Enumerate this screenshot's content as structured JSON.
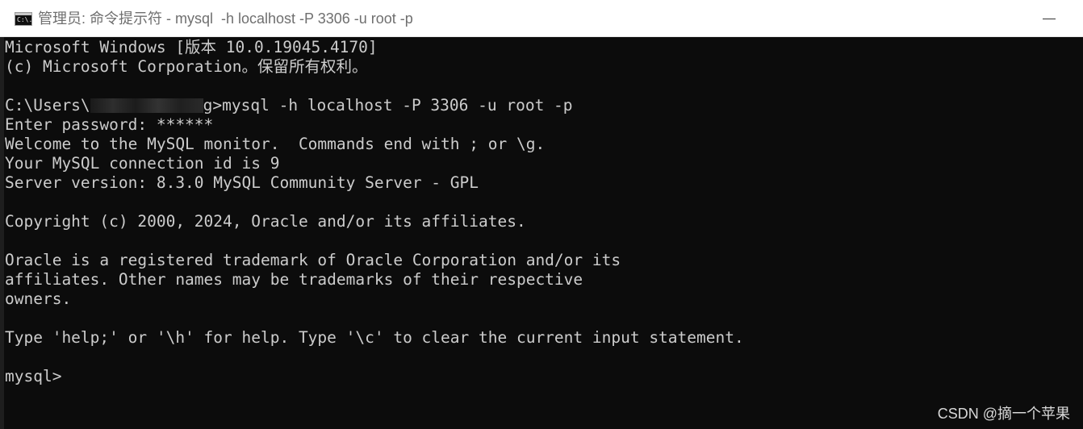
{
  "window": {
    "title": "管理员: 命令提示符 - mysql  -h localhost -P 3306 -u root -p",
    "icon": "cmd-icon",
    "icon_prompt": "C:\\."
  },
  "console": {
    "lines": [
      "Microsoft Windows [版本 10.0.19045.4170]",
      "(c) Microsoft Corporation。保留所有权利。",
      "",
      "",
      "Enter password: ******",
      "Welcome to the MySQL monitor.  Commands end with ; or \\g.",
      "Your MySQL connection id is 9",
      "Server version: 8.3.0 MySQL Community Server - GPL",
      "",
      "Copyright (c) 2000, 2024, Oracle and/or its affiliates.",
      "",
      "Oracle is a registered trademark of Oracle Corporation and/or its",
      "affiliates. Other names may be trademarks of their respective",
      "owners.",
      "",
      "Type 'help;' or '\\h' for help. Type '\\c' to clear the current input statement.",
      "",
      "mysql>"
    ],
    "path_prefix": "C:\\Users\\",
    "path_suffix": "g>",
    "command": "mysql -h localhost -P 3306 -u root -p"
  },
  "watermark": "CSDN @摘一个苹果",
  "colors": {
    "console_bg": "#0c0c0c",
    "console_fg": "#cccccc",
    "titlebar_bg": "#ffffff",
    "title_fg": "#6f6f6f"
  }
}
